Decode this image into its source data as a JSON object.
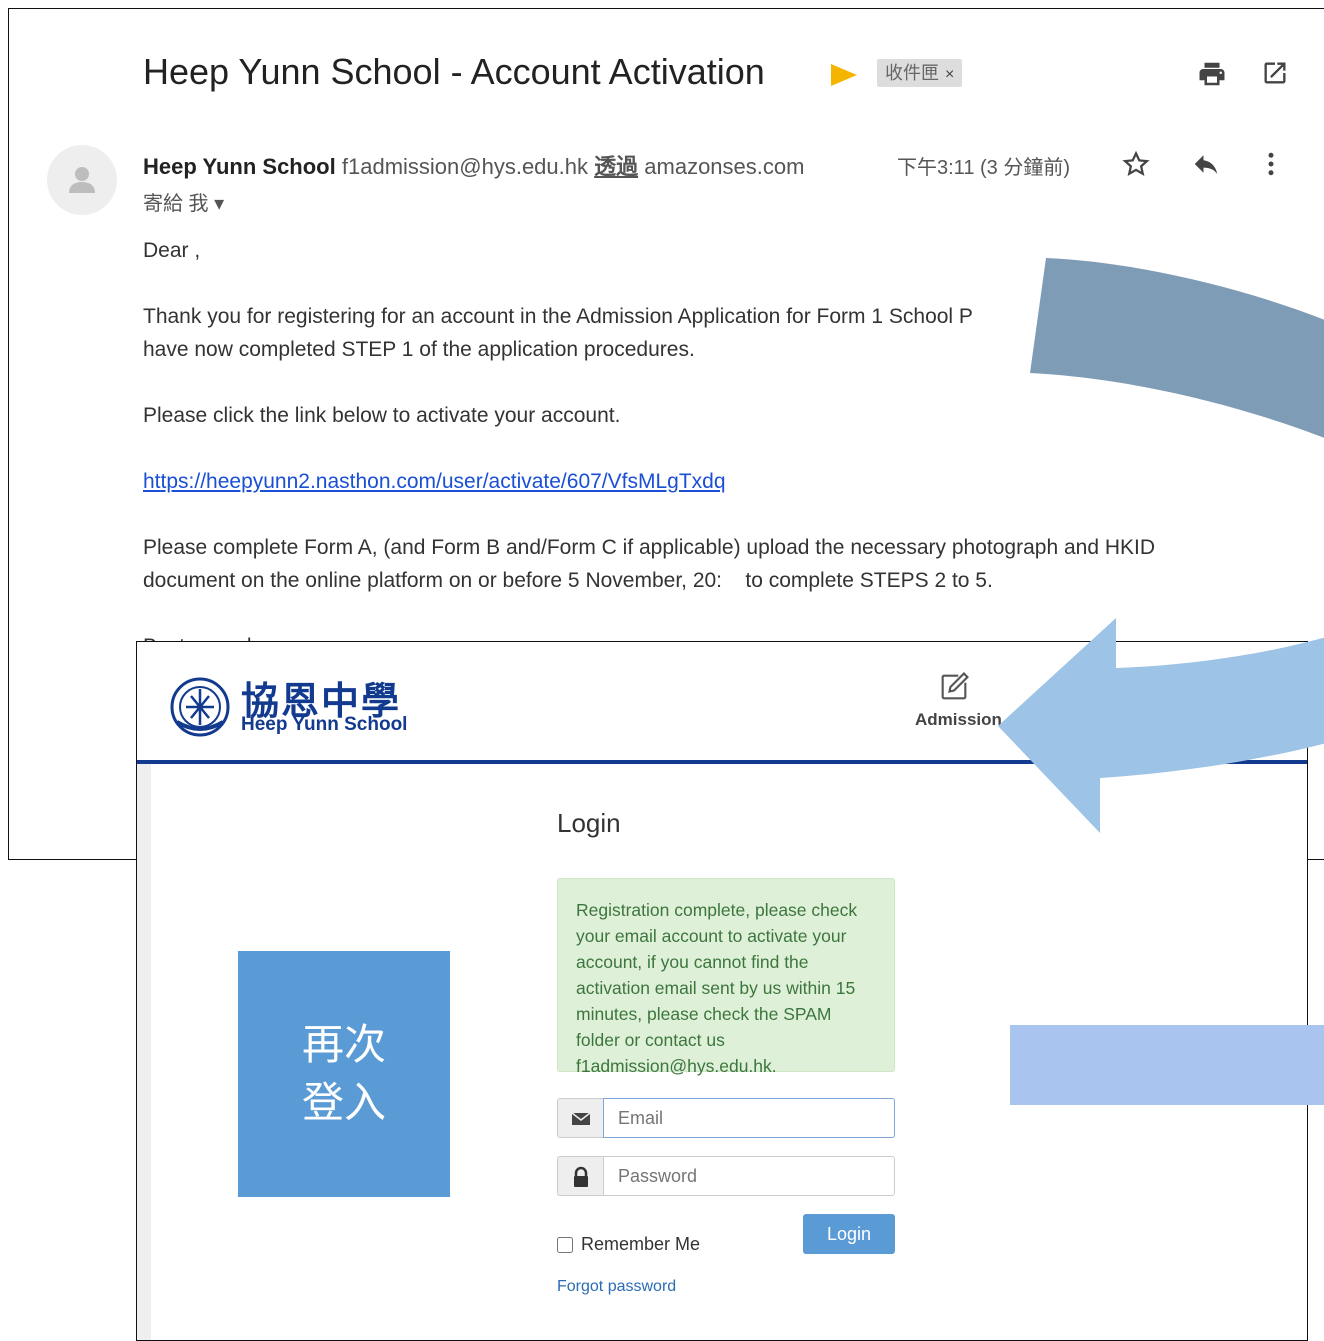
{
  "email": {
    "subject": "Heep Yunn School - Account Activation",
    "inbox_label": "收件匣",
    "inbox_close": "×",
    "sender_name": "Heep Yunn School",
    "sender_email": "f1admission@hys.edu.hk",
    "via_label": "透過",
    "via_domain": "amazonses.com",
    "to_label": "寄給 我 ▾",
    "time": "下午3:11 (3 分鐘前)",
    "greeting": "Dear ,",
    "para1": "Thank you for registering for an account in the Admission Application for Form 1 School P",
    "para1b": "have now completed STEP 1 of the application procedures.",
    "para2": "Please click the link below to activate your account.",
    "link": "https://heepyunn2.nasthon.com/user/activate/607/VfsMLgTxdq",
    "para3": "Please complete Form A, (and Form B and/Form C if applicable) upload the necessary photograph and HKID",
    "para3b": "document on the online platform on or before 5 November, 20:    to complete STEPS 2 to 5.",
    "closing": "Best regards,"
  },
  "site": {
    "school_name_cn": "協恩中學",
    "school_name_en": "Heep Yunn School",
    "nav_admission": "Admission",
    "login_title": "Login",
    "alert_text": "Registration complete, please check your email account to activate your account, if you cannot find the activation email sent by us within 15 minutes, please check the SPAM folder or contact us f1admission@hys.edu.hk.",
    "email_placeholder": "Email",
    "password_placeholder": "Password",
    "remember_label": "Remember Me",
    "login_button": "Login",
    "forgot_link": "Forgot password"
  },
  "overlay": {
    "relogin_text": "再次登入"
  },
  "colors": {
    "brand_blue": "#123a8f",
    "button_blue": "#5b9bd5",
    "alert_green_bg": "#dff0d8",
    "alert_green_text": "#3c763d",
    "arrow_dark": "#7f9cb7",
    "arrow_light": "#9dc3e6",
    "important_marker": "#f4b400"
  },
  "icons": [
    "important-marker-icon",
    "print-icon",
    "open-new-window-icon",
    "person-icon",
    "star-icon",
    "reply-icon",
    "more-vert-icon",
    "school-crest-icon",
    "edit-icon",
    "envelope-icon",
    "lock-icon"
  ]
}
